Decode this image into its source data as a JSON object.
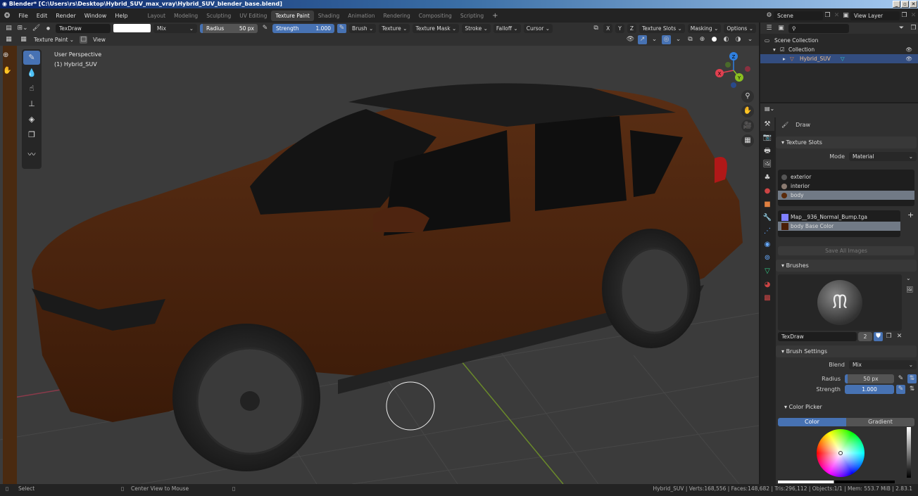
{
  "window": {
    "title": "Blender* [C:\\Users\\rs\\Desktop\\Hybrid_SUV_max_vray\\Hybrid_SUV_blender_base.blend]",
    "buttons": [
      "_",
      "▫",
      "✕"
    ]
  },
  "menu": {
    "items": [
      "File",
      "Edit",
      "Render",
      "Window",
      "Help"
    ],
    "workspaces": [
      "Layout",
      "Modeling",
      "Sculpting",
      "UV Editing",
      "Texture Paint",
      "Shading",
      "Animation",
      "Rendering",
      "Compositing",
      "Scripting"
    ],
    "active_workspace": "Texture Paint",
    "add": "+",
    "scene": "Scene",
    "view_layer": "View Layer"
  },
  "tool_header": {
    "brush_name": "TexDraw",
    "color_hex": "#ffffff",
    "blend": "Mix",
    "radius_label": "Radius",
    "radius_value": "50 px",
    "strength_label": "Strength",
    "strength_value": "1.000",
    "menus": [
      "Brush",
      "Texture",
      "Texture Mask",
      "Stroke",
      "Falloff",
      "Cursor"
    ],
    "axes": [
      "X",
      "Y",
      "Z"
    ],
    "right_menus": [
      "Texture Slots",
      "Masking",
      "Options"
    ]
  },
  "header2": {
    "mode": "Texture Paint",
    "view": "View"
  },
  "viewport": {
    "perspective": "User Perspective",
    "object": "(1) Hybrid_SUV",
    "gizmo": {
      "x": "X",
      "y": "Y",
      "z": "Z"
    }
  },
  "outliner": {
    "search_placeholder": "",
    "scene_collection": "Scene Collection",
    "collection": "Collection",
    "object": "Hybrid_SUV"
  },
  "properties": {
    "tool_name": "Draw",
    "texture_slots": {
      "title": "Texture Slots",
      "mode_label": "Mode",
      "mode_value": "Material",
      "materials": [
        {
          "name": "exterior",
          "color": "#555555"
        },
        {
          "name": "interior",
          "color": "#8a7a70"
        },
        {
          "name": "body",
          "color": "#5a2a0a",
          "selected": true
        }
      ],
      "images": [
        {
          "name": "Map__936_Normal_Bump.tga",
          "color": "#8080ff"
        },
        {
          "name": "body Base Color",
          "color": "#4a1e05",
          "selected": true
        }
      ],
      "save_all": "Save All Images"
    },
    "brushes": {
      "title": "Brushes",
      "brush_name": "TexDraw",
      "users": "2"
    },
    "brush_settings": {
      "title": "Brush Settings",
      "blend_label": "Blend",
      "blend_value": "Mix",
      "radius_label": "Radius",
      "radius_value": "50 px",
      "strength_label": "Strength",
      "strength_value": "1.000",
      "strength_fraction": 1.0
    },
    "color_picker": {
      "title": "Color Picker",
      "tabs": [
        "Color",
        "Gradient"
      ],
      "active_tab": "Color",
      "value_fraction": 1.0
    }
  },
  "status": {
    "left": "Select",
    "middle": "Center View to Mouse",
    "right": "Hybrid_SUV | Verts:168,556 | Faces:148,682 | Tris:296,112 | Objects:1/1 | Mem: 553.7 MiB | 2.83.1"
  }
}
